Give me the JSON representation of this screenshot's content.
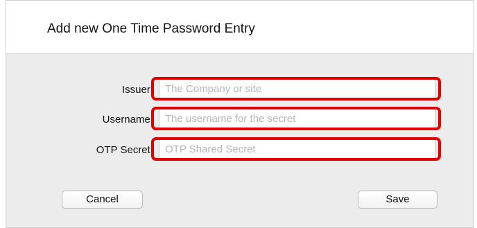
{
  "dialog": {
    "title": "Add new One Time Password Entry",
    "fields": [
      {
        "label": "Issuer:",
        "value": "",
        "placeholder": "The Company or site"
      },
      {
        "label": "Username:",
        "value": "",
        "placeholder": "The username for the secret"
      },
      {
        "label": "OTP Secret:",
        "value": "",
        "placeholder": "OTP Shared Secret"
      }
    ],
    "buttons": {
      "cancel": "Cancel",
      "save": "Save"
    },
    "highlight_color": "#e00000"
  }
}
